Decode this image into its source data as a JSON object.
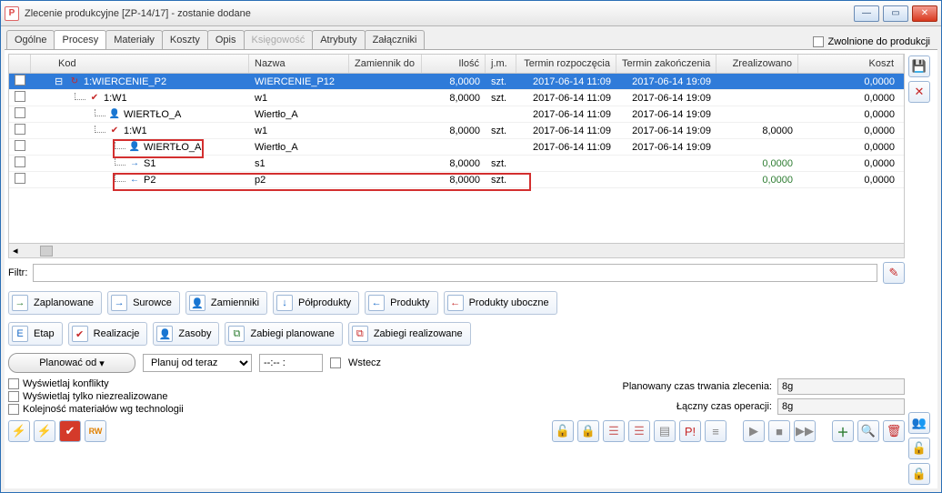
{
  "title": "Zlecenie produkcyjne  [ZP-14/17] - zostanie dodane",
  "zwolnione": "Zwolnione do produkcji",
  "tabs": [
    "Ogólne",
    "Procesy",
    "Materiały",
    "Koszty",
    "Opis",
    "Księgowość",
    "Atrybuty",
    "Załączniki"
  ],
  "headers": {
    "kod": "Kod",
    "nazwa": "Nazwa",
    "zam": "Zamiennik do",
    "ilosc": "Ilość",
    "jm": "j.m.",
    "start": "Termin rozpoczęcia",
    "end": "Termin zakończenia",
    "real": "Zrealizowano",
    "koszt": "Koszt"
  },
  "rows": [
    {
      "indent": 0,
      "icon": "refresh",
      "kod": "1:WIERCENIE_P2",
      "nazwa": "WIERCENIE_P12",
      "ilosc": "8,0000",
      "jm": "szt.",
      "start": "2017-06-14 11:09",
      "end": "2017-06-14 19:09",
      "real": "",
      "koszt": "0,0000",
      "sel": true
    },
    {
      "indent": 1,
      "icon": "checkred",
      "kod": "1:W1",
      "nazwa": "w1",
      "ilosc": "8,0000",
      "jm": "szt.",
      "start": "2017-06-14 11:09",
      "end": "2017-06-14 19:09",
      "real": "",
      "koszt": "0,0000"
    },
    {
      "indent": 2,
      "icon": "person",
      "kod": "WIERTŁO_A",
      "nazwa": "Wiertło_A",
      "ilosc": "",
      "jm": "",
      "start": "2017-06-14 11:09",
      "end": "2017-06-14 19:09",
      "real": "",
      "koszt": "0,0000"
    },
    {
      "indent": 2,
      "icon": "checkred",
      "kod": "1:W1",
      "nazwa": "w1",
      "ilosc": "8,0000",
      "jm": "szt.",
      "start": "2017-06-14 11:09",
      "end": "2017-06-14 19:09",
      "real": "8,0000",
      "koszt": "0,0000"
    },
    {
      "indent": 3,
      "icon": "person",
      "kod": "WIERTŁO_A",
      "nazwa": "Wiertło_A",
      "ilosc": "",
      "jm": "",
      "start": "2017-06-14 11:09",
      "end": "2017-06-14 19:09",
      "real": "",
      "koszt": "0,0000",
      "hl": "name"
    },
    {
      "indent": 3,
      "icon": "arrR",
      "kod": "S1",
      "nazwa": "s1",
      "ilosc": "8,0000",
      "jm": "szt.",
      "start": "",
      "end": "",
      "real": "0,0000",
      "realgreen": true,
      "koszt": "0,0000"
    },
    {
      "indent": 3,
      "icon": "arrL",
      "kod": "P2",
      "nazwa": "p2",
      "ilosc": "8,0000",
      "jm": "szt.",
      "start": "",
      "end": "",
      "real": "0,0000",
      "realgreen": true,
      "koszt": "0,0000",
      "hl": "row"
    }
  ],
  "filter_label": "Filtr:",
  "actions1": [
    {
      "ico": "→",
      "col": "#2e7d32",
      "label": "Zaplanowane"
    },
    {
      "ico": "→",
      "col": "#1668c7",
      "label": "Surowce"
    },
    {
      "ico": "👤",
      "col": "#1668c7",
      "label": "Zamienniki"
    },
    {
      "ico": "↓",
      "col": "#1668c7",
      "label": "Półprodukty"
    },
    {
      "ico": "←",
      "col": "#1668c7",
      "label": "Produkty"
    },
    {
      "ico": "←",
      "col": "#c62828",
      "label": "Produkty uboczne"
    }
  ],
  "actions2": [
    {
      "ico": "E",
      "col": "#1668c7",
      "label": "Etap"
    },
    {
      "ico": "✔",
      "col": "#c62828",
      "label": "Realizacje"
    },
    {
      "ico": "👤",
      "col": "#b08000",
      "label": "Zasoby"
    },
    {
      "ico": "⧉",
      "col": "#2e7d32",
      "label": "Zabiegi planowane"
    },
    {
      "ico": "⧉",
      "col": "#c62828",
      "label": "Zabiegi realizowane"
    }
  ],
  "plan_button": "Planować od",
  "plan_combo": "Planuj od teraz",
  "plan_time": "--:-- :",
  "wstecz": "Wstecz",
  "opts": [
    "Wyświetlaj konflikty",
    "Wyświetlaj tylko niezrealizowane",
    "Kolejność materiałów wg technologii"
  ],
  "sum1_label": "Planowany czas trwania zlecenia:",
  "sum1_val": "8g",
  "sum2_label": "Łączny czas operacji:",
  "sum2_val": "8g"
}
